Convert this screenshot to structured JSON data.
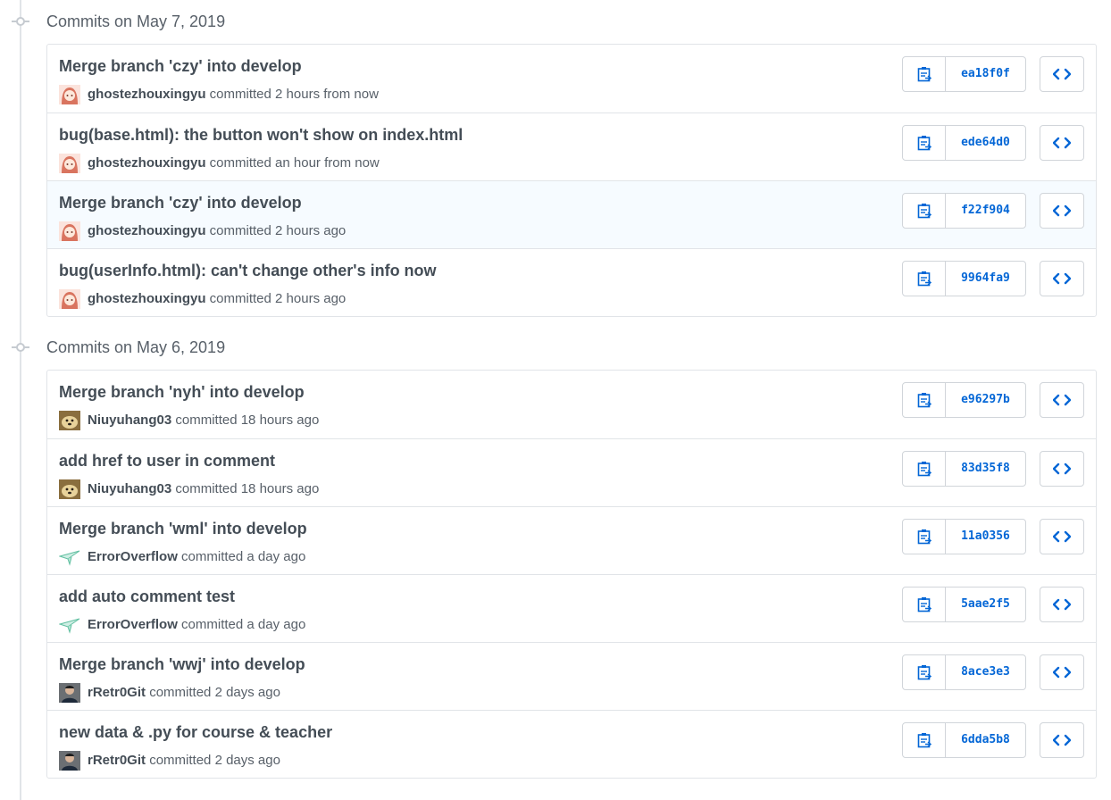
{
  "colors": {
    "link": "#0366d6",
    "border": "#e1e4e8",
    "muted": "#586069"
  },
  "groups": [
    {
      "header": "Commits on May 7, 2019",
      "commits": [
        {
          "title": "Merge branch 'czy' into develop",
          "author": "ghostezhouxingyu",
          "verb": "committed",
          "time": "2 hours from now",
          "sha": "ea18f0f",
          "avatar": "anime-avatar"
        },
        {
          "title": "bug(base.html): the button won't show on index.html",
          "author": "ghostezhouxingyu",
          "verb": "committed",
          "time": "an hour from now",
          "sha": "ede64d0",
          "avatar": "anime-avatar"
        },
        {
          "title": "Merge branch 'czy' into develop",
          "author": "ghostezhouxingyu",
          "verb": "committed",
          "time": "2 hours ago",
          "sha": "f22f904",
          "avatar": "anime-avatar"
        },
        {
          "title": "bug(userInfo.html): can't change other's info now",
          "author": "ghostezhouxingyu",
          "verb": "committed",
          "time": "2 hours ago",
          "sha": "9964fa9",
          "avatar": "anime-avatar"
        }
      ]
    },
    {
      "header": "Commits on May 6, 2019",
      "commits": [
        {
          "title": "Merge branch 'nyh' into develop",
          "author": "Niuyuhang03",
          "verb": "committed",
          "time": "18 hours ago",
          "sha": "e96297b",
          "avatar": "dog-avatar"
        },
        {
          "title": "add href to user in comment",
          "author": "Niuyuhang03",
          "verb": "committed",
          "time": "18 hours ago",
          "sha": "83d35f8",
          "avatar": "dog-avatar"
        },
        {
          "title": "Merge branch 'wml' into develop",
          "author": "ErrorOverflow",
          "verb": "committed",
          "time": "a day ago",
          "sha": "11a0356",
          "avatar": "paper-plane-avatar"
        },
        {
          "title": "add auto comment test",
          "author": "ErrorOverflow",
          "verb": "committed",
          "time": "a day ago",
          "sha": "5aae2f5",
          "avatar": "paper-plane-avatar"
        },
        {
          "title": "Merge branch 'wwj' into develop",
          "author": "rRetr0Git",
          "verb": "committed",
          "time": "2 days ago",
          "sha": "8ace3e3",
          "avatar": "person-avatar"
        },
        {
          "title": "new data & .py for course & teacher",
          "author": "rRetr0Git",
          "verb": "committed",
          "time": "2 days ago",
          "sha": "6dda5b8",
          "avatar": "person-avatar"
        }
      ]
    }
  ]
}
